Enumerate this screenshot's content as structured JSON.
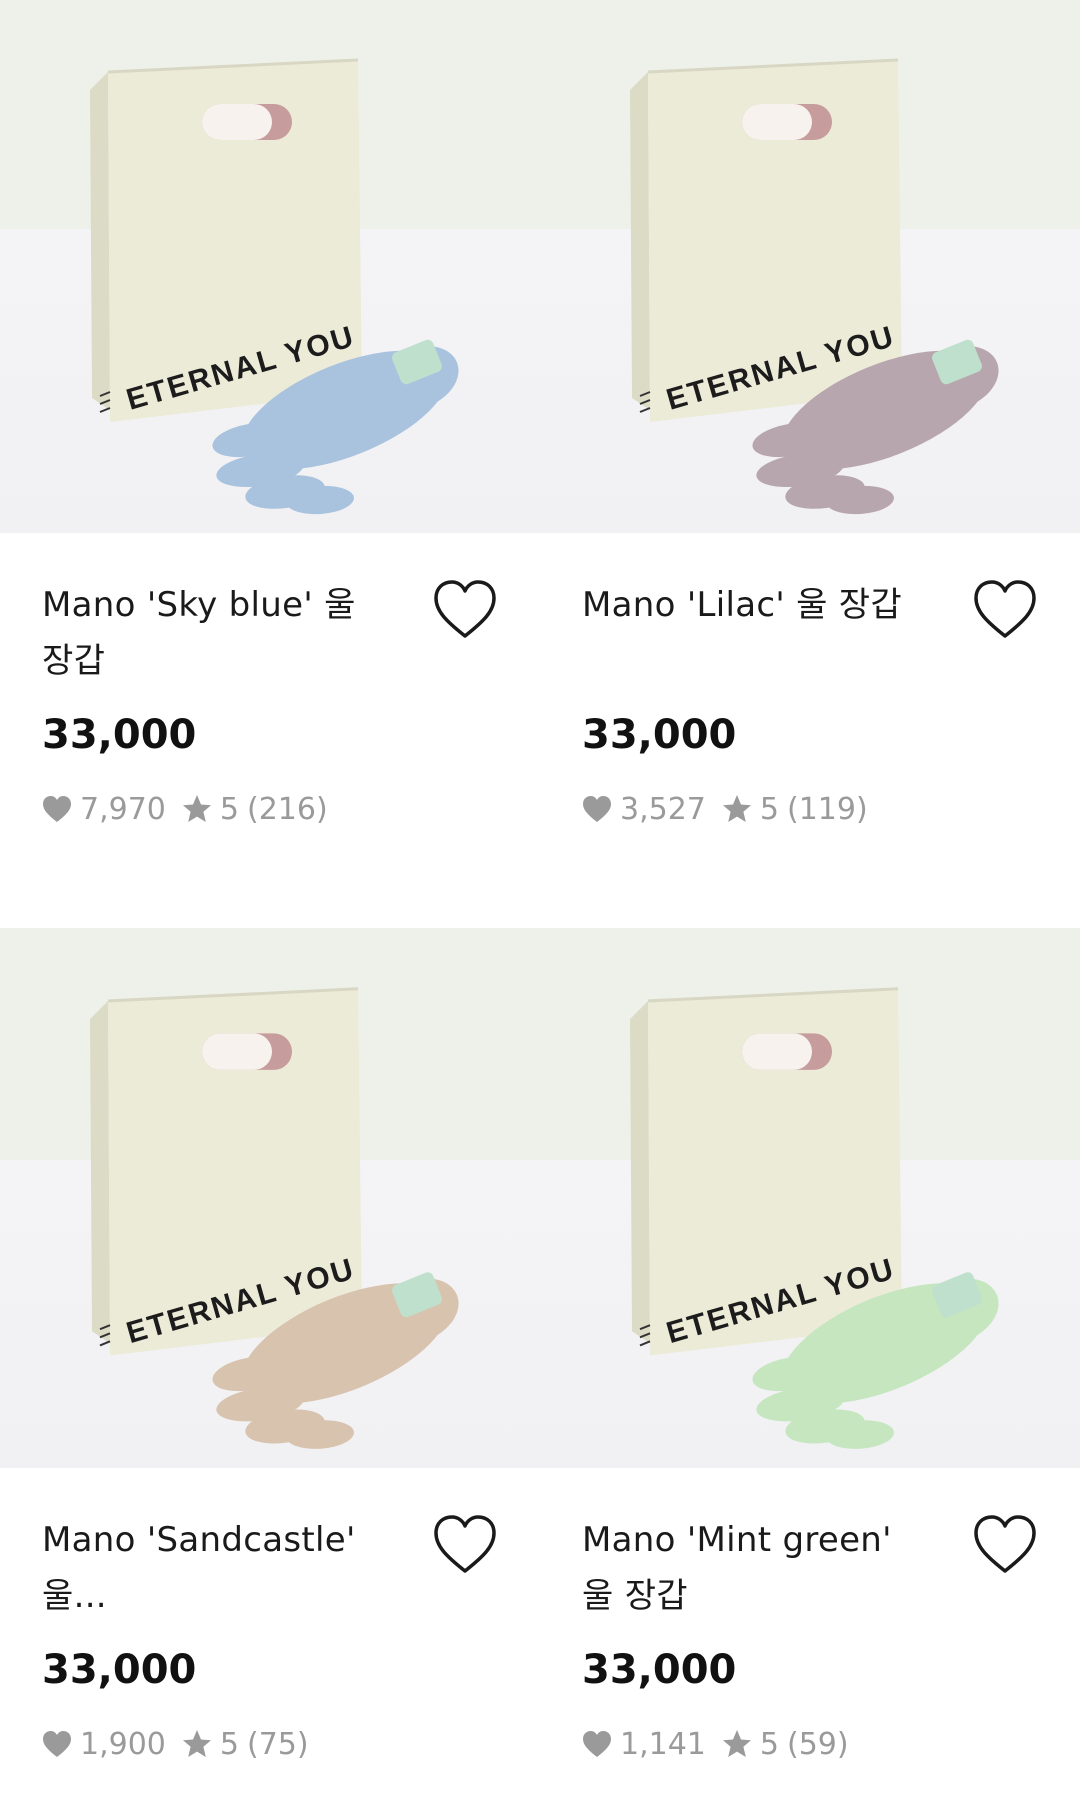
{
  "products": [
    {
      "name": "Mano 'Sky blue' 울 장갑",
      "price": "33,000",
      "likes": "7,970",
      "rating": "5",
      "reviews": "(216)",
      "glove_color": "#a9c3df",
      "brand_text": "ETERNAL YOU"
    },
    {
      "name": "Mano 'Lilac' 울 장갑",
      "price": "33,000",
      "likes": "3,527",
      "rating": "5",
      "reviews": "(119)",
      "glove_color": "#b7a6ae",
      "brand_text": "ETERNAL YOU"
    },
    {
      "name": "Mano 'Sandcastle' 울...",
      "price": "33,000",
      "likes": "1,900",
      "rating": "5",
      "reviews": "(75)",
      "glove_color": "#d8c3ae",
      "brand_text": "ETERNAL YOU"
    },
    {
      "name": "Mano 'Mint green' 울 장갑",
      "price": "33,000",
      "likes": "1,141",
      "rating": "5",
      "reviews": "(59)",
      "glove_color": "#c6e6c0",
      "brand_text": "ETERNAL YOU"
    }
  ],
  "icons": {
    "wishlist": "heart-outline-icon",
    "likes": "heart-filled-icon",
    "rating": "star-icon"
  },
  "colors": {
    "text": "#111111",
    "muted": "#9a9a9a",
    "bag": "#ecebd8"
  }
}
